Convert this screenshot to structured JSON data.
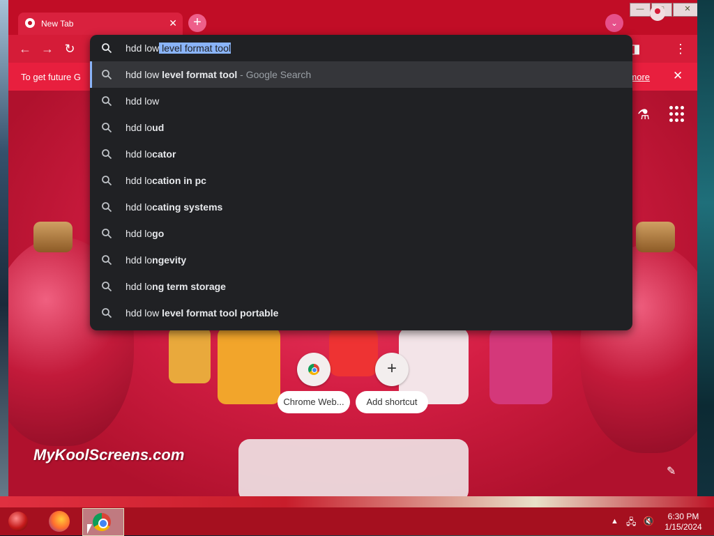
{
  "window": {
    "tab_title": "New Tab",
    "tab_close": "✕",
    "new_tab": "+",
    "tab_search": "⌄",
    "controls": {
      "minimize": "—",
      "maximize": "□",
      "close": "✕"
    }
  },
  "toolbar": {
    "back": "←",
    "forward": "→",
    "reload": "↻",
    "side_panel": "◨",
    "menu": "⋮"
  },
  "infobar": {
    "message": "To get future G",
    "link": "arn more",
    "close": "✕"
  },
  "omnibox": {
    "typed": "hdd low",
    "autocomplete": " level format tool",
    "suggestions": [
      {
        "prefix": "hdd low",
        "bold": " level format tool",
        "hint": " - Google Search"
      },
      {
        "prefix": "hdd low",
        "bold": "",
        "hint": ""
      },
      {
        "prefix": "hdd lo",
        "bold": "ud",
        "hint": ""
      },
      {
        "prefix": "hdd lo",
        "bold": "cator",
        "hint": ""
      },
      {
        "prefix": "hdd lo",
        "bold": "cation in pc",
        "hint": ""
      },
      {
        "prefix": "hdd lo",
        "bold": "cating systems",
        "hint": ""
      },
      {
        "prefix": "hdd lo",
        "bold": "go",
        "hint": ""
      },
      {
        "prefix": "hdd lo",
        "bold": "ngevity",
        "hint": ""
      },
      {
        "prefix": "hdd lo",
        "bold": "ng term storage",
        "hint": ""
      },
      {
        "prefix": "hdd low",
        "bold": " level format tool portable",
        "hint": ""
      }
    ]
  },
  "ntp": {
    "labs_icon": "⚗",
    "shortcuts": [
      {
        "label": "Chrome Web...",
        "icon": "chrome-web-store-icon"
      },
      {
        "label": "Add shortcut",
        "icon": "+"
      }
    ],
    "customize": "✎"
  },
  "watermark": "MyKoolScreens.com",
  "taskbar": {
    "tray_up": "▲",
    "network": "🖧",
    "volume": "🔇",
    "time": "6:30 PM",
    "date": "1/15/2024"
  },
  "colors": {
    "frame": "#c10d26",
    "omnibox_bg": "#202124",
    "selection": "#8ab4f8"
  }
}
